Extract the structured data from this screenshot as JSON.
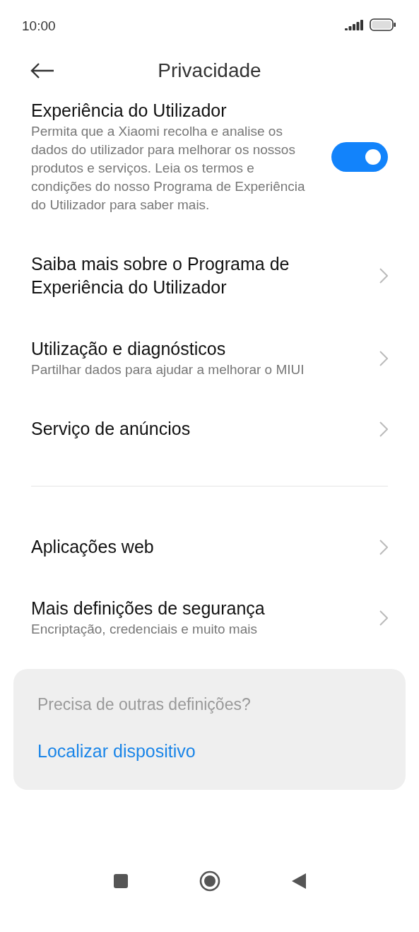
{
  "status_bar": {
    "time": "10:00"
  },
  "header": {
    "title": "Privacidade"
  },
  "sections": [
    {
      "items": [
        {
          "kind": "toggle",
          "title": "Experiência do Utilizador",
          "subtitle": "Permita que a Xiaomi recolha e analise os dados do utilizador para melhorar os nossos produtos e serviços. Leia os termos e condições do nosso Programa de Experiência do Utilizador para saber mais.",
          "on": true
        },
        {
          "kind": "link",
          "title": "Saiba mais sobre o Programa de Experiência do Utilizador"
        },
        {
          "kind": "link",
          "title": "Utilização e diagnósticos",
          "subtitle": "Partilhar dados para ajudar a melhorar o MIUI"
        },
        {
          "kind": "link",
          "title": "Serviço de anúncios"
        }
      ]
    },
    {
      "items": [
        {
          "kind": "link",
          "title": "Aplicações web"
        },
        {
          "kind": "link",
          "title": "Mais definições de segurança",
          "subtitle": "Encriptação, credenciais e muito mais"
        }
      ]
    }
  ],
  "card": {
    "question": "Precisa de outras definições?",
    "link": "Localizar dispositivo"
  }
}
